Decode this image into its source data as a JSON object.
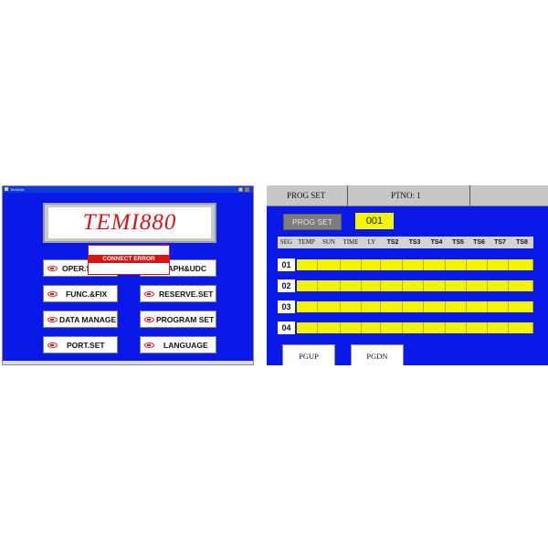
{
  "left_panel": {
    "window_title": "TemiEdit",
    "logo": "TEMI880",
    "error_popup": "CONNECT ERROR",
    "menu": {
      "oper_set": "OPER.SE",
      "graph_udc": "APH&UDC",
      "func_fix": "FUNC.&FIX",
      "reserve_set": "RESERVE.SET",
      "data_manage": "DATA MANAGE",
      "program_set": "PROGRAM SET",
      "port_set": "PORT.SET",
      "language": "LANGUAGE"
    }
  },
  "right_panel": {
    "header": {
      "title": "PROG SET",
      "ptno": "PTNO: 1"
    },
    "prog_set_button": "PROG SET",
    "ptno_value": "001",
    "columns": [
      "SEG",
      "TEMP",
      "SUN",
      "TIME",
      "LY",
      "TS2",
      "TS3",
      "TS4",
      "TS5",
      "TS6",
      "TS7",
      "TS8"
    ],
    "segments": [
      "01",
      "02",
      "03",
      "04"
    ],
    "pgup": "PGUP",
    "pgdn": "PGDN"
  },
  "colors": {
    "screen_blue": "#0a18e8",
    "field_yellow": "#f4f400",
    "logo_red": "#d81414"
  }
}
